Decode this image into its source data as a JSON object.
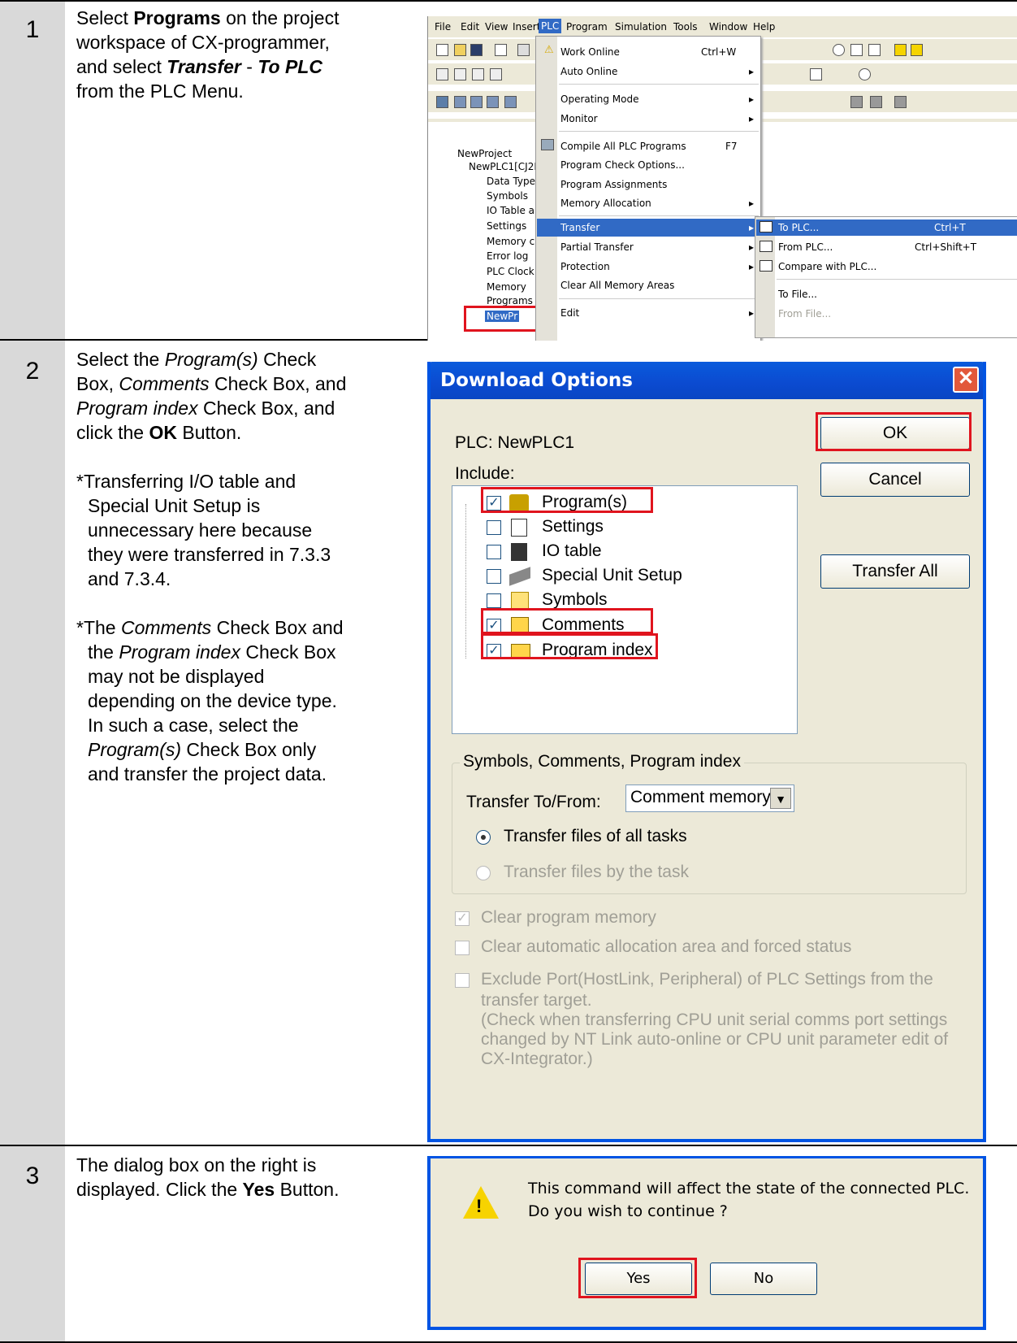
{
  "steps": [
    {
      "num": "1"
    },
    {
      "num": "2"
    },
    {
      "num": "3"
    }
  ],
  "step1": {
    "l1a": "Select ",
    "l1b": "Programs",
    "l1c": " on the project",
    "l2": "workspace of CX-programmer,",
    "l3a": "and select ",
    "l3b": "Transfer",
    "l3c": " - ",
    "l3d": "To PLC",
    "l4": "from the PLC Menu."
  },
  "step2": {
    "l1a": "Select the ",
    "l1b": "Program(s)",
    "l1c": " Check",
    "l2a": "Box, ",
    "l2b": "Comments",
    "l2c": " Check Box, and",
    "l3a": "Program index",
    "l3b": " Check Box, and",
    "l4a": "click the ",
    "l4b": "OK",
    "l4c": " Button.",
    "n1": "*Transferring I/O table and",
    "n2": "Special Unit Setup is",
    "n3": "unnecessary here because",
    "n4": "they were transferred in 7.3.3",
    "n5": "and 7.3.4.",
    "m1a": "*The ",
    "m1b": "Comments",
    "m1c": " Check Box and",
    "m2a": "the ",
    "m2b": "Program index",
    "m2c": " Check Box",
    "m3": "may not be displayed",
    "m4": "depending on the device type.",
    "m5": "In such a case, select the",
    "m6a": "Program(s)",
    "m6b": " Check Box only",
    "m7": "and transfer the project data."
  },
  "step3": {
    "l1": "The dialog box on the right is",
    "l2a": "displayed. Click the ",
    "l2b": "Yes",
    "l2c": " Button."
  },
  "menubar": [
    "File",
    "Edit",
    "View",
    "Insert",
    "PLC",
    "Program",
    "Simulation",
    "Tools",
    "Window",
    "Help"
  ],
  "tree": {
    "project": "NewProject",
    "plc": "NewPLC1[CJ2M",
    "datatype": "Data Type",
    "symbols": "Symbols",
    "iotable": "IO Table a",
    "settings": "Settings",
    "memcard": "Memory ca",
    "errorlog": "Error log",
    "clock": "PLC Clock",
    "memory": "Memory",
    "programs": "Programs",
    "newpr": "NewPr"
  },
  "plc_menu": {
    "work_online": "Work Online",
    "work_online_key": "Ctrl+W",
    "auto_online": "Auto Online",
    "operating_mode": "Operating Mode",
    "monitor": "Monitor",
    "compile": "Compile All PLC Programs",
    "compile_key": "F7",
    "check_options": "Program Check Options...",
    "assignments": "Program Assignments",
    "memory_alloc": "Memory Allocation",
    "transfer": "Transfer",
    "partial": "Partial Transfer",
    "protection": "Protection",
    "clear_all": "Clear All Memory Areas",
    "edit": "Edit"
  },
  "transfer_menu": {
    "to_plc": "To PLC...",
    "to_plc_key": "Ctrl+T",
    "from_plc": "From PLC...",
    "from_plc_key": "Ctrl+Shift+T",
    "compare": "Compare with PLC...",
    "to_file": "To File...",
    "from_file": "From File..."
  },
  "download": {
    "title": "Download Options",
    "plc_label": "PLC:  NewPLC1",
    "include": "Include:",
    "ok": "OK",
    "cancel": "Cancel",
    "transfer_all": "Transfer All",
    "items": [
      "Program(s)",
      "Settings",
      "IO table",
      "Special Unit Setup",
      "Symbols",
      "Comments",
      "Program index"
    ],
    "group": "Symbols, Comments, Program index",
    "transfer_to": "Transfer To/From:",
    "comment_memory": "Comment memory",
    "radio_all": "Transfer files of all tasks",
    "radio_task": "Transfer files by the task",
    "clear_prog": "Clear program memory",
    "clear_auto": "Clear automatic allocation area and forced status",
    "exclude1": "Exclude Port(HostLink, Peripheral) of PLC Settings from the",
    "exclude2": "transfer target.",
    "exclude3": "(Check when transferring CPU unit serial comms port settings",
    "exclude4": "changed by NT Link auto-online or CPU unit parameter edit of",
    "exclude5": "CX-Integrator.)"
  },
  "confirm": {
    "msg1": "This command will affect the state of the connected PLC.",
    "msg2": "Do you wish to continue ?",
    "yes": "Yes",
    "no": "No"
  }
}
